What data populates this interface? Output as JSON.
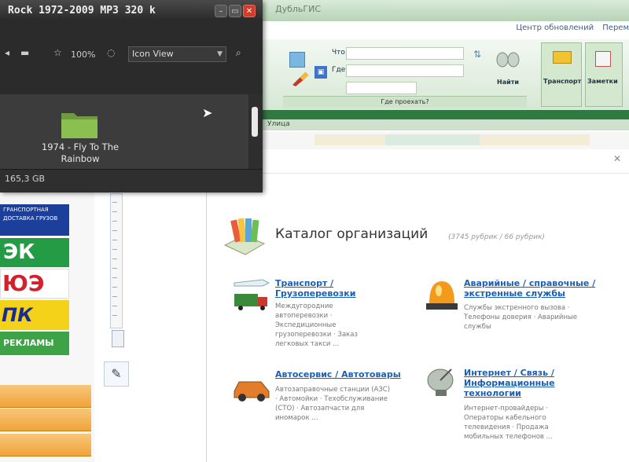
{
  "file_manager": {
    "title": "Rock  1972-2009  MP3  320 k",
    "window_buttons": {
      "minimize": "–",
      "maximize": "▭",
      "close": "✕"
    },
    "zoom": "100%",
    "view_mode": "Icon View",
    "folder": {
      "name": "1974 - Fly To The Rainbow"
    },
    "free_space": "165,3 GB"
  },
  "background_app": {
    "title": "ДубльГИС",
    "header_links": [
      "Центр обновлений",
      "Перем"
    ],
    "ribbon": {
      "field_labels": [
        "Что",
        "Где"
      ],
      "search_group_label": "Где проехать?",
      "buttons": [
        "Найти",
        "Транспорт",
        "Заметки"
      ]
    },
    "address_tab": "Улица",
    "adverts": [
      "ГРАНСПОРТНАЯ ДОСТАВКА ГРУЗОВ",
      "ЭК",
      "ЮЭ",
      "ПК",
      "РЕКЛАМЫ"
    ]
  },
  "catalog": {
    "title": "Каталог организаций",
    "count": "(3745 рубрик / 66 рубрик)",
    "categories": [
      {
        "title": "Транспорт / Грузоперевозки",
        "desc": "Междугородние автоперевозки · Экспедиционные грузоперевозки · Заказ легковых такси ..."
      },
      {
        "title": "Аварийные / справочные / экстренные службы",
        "desc": "Службы экстренного вызова · Телефоны доверия · Аварийные службы"
      },
      {
        "title": "Автосервис / Автотовары",
        "desc": "Автозаправочные станции (АЗС) · Автомойки · Техобслуживание (СТО) · Автозапчасти для иномарок ..."
      },
      {
        "title": "Интернет / Связь / Информационные технологии",
        "desc": "Интернет-провайдеры · Операторы кабельного телевидения · Продажа мобильных телефонов ..."
      }
    ]
  },
  "colors": {
    "ribbon_green": "#2f7a40",
    "link_blue": "#1a5fb4",
    "close_red": "#d33b2a",
    "orange_button": "#f0a33a"
  }
}
